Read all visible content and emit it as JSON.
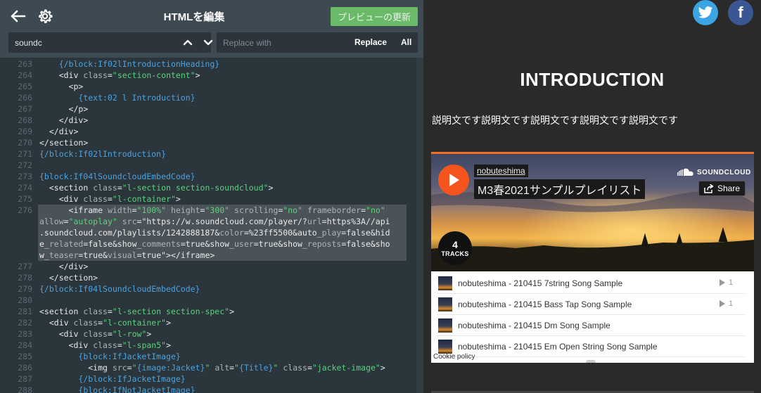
{
  "editor": {
    "title": "HTMLを編集",
    "preview_button": "プレビューの更新",
    "search_value": "soundc",
    "replace_placeholder": "Replace with",
    "replace_label": "Replace",
    "all_label": "All"
  },
  "code_lines": [
    {
      "n": "263",
      "text": "    {/block:If02lIntroductionHeading}"
    },
    {
      "n": "264",
      "text": "    <div class=\"section-content\">"
    },
    {
      "n": "265",
      "text": "      <p>"
    },
    {
      "n": "266",
      "text": "        {text:02 l Introduction}"
    },
    {
      "n": "267",
      "text": "      </p>"
    },
    {
      "n": "268",
      "text": "    </div>"
    },
    {
      "n": "269",
      "text": "  </div>"
    },
    {
      "n": "270",
      "text": "</section>"
    },
    {
      "n": "271",
      "text": "{/block:If02lIntroduction}"
    },
    {
      "n": "272",
      "text": ""
    },
    {
      "n": "273",
      "text": "{block:If04lSoundcloudEmbedCode}"
    },
    {
      "n": "274",
      "text": "  <section class=\"l-section section-soundcloud\">"
    },
    {
      "n": "275",
      "text": "    <div class=\"l-container\">"
    },
    {
      "n": "276",
      "text": "      <iframe width=\"100%\" height=\"300\" scrolling=\"no\" frameborder=\"no\""
    },
    {
      "n": "",
      "text": "allow=\"autoplay\" src=\"https://w.soundcloud.com/player/?url=https%3A//api"
    },
    {
      "n": "",
      "text": ".soundcloud.com/playlists/1242888187&color=%23ff5500&auto_play=false&hid"
    },
    {
      "n": "",
      "text": "e_related=false&show_comments=true&show_user=true&show_reposts=false&sho"
    },
    {
      "n": "",
      "text": "w_teaser=true&visual=true\"></iframe>"
    },
    {
      "n": "277",
      "text": "    </div>"
    },
    {
      "n": "278",
      "text": "  </section>"
    },
    {
      "n": "279",
      "text": "{/block:If04lSoundcloudEmbedCode}"
    },
    {
      "n": "280",
      "text": ""
    },
    {
      "n": "281",
      "text": "<section class=\"l-section section-spec\">"
    },
    {
      "n": "282",
      "text": "  <div class=\"l-container\">"
    },
    {
      "n": "283",
      "text": "    <div class=\"l-row\">"
    },
    {
      "n": "284",
      "text": "      <div class=\"l-span5\">"
    },
    {
      "n": "285",
      "text": "        {block:IfJacketImage}"
    },
    {
      "n": "286",
      "text": "          <img src=\"{image:Jacket}\" alt=\"{Title}\" class=\"jacket-image\">"
    },
    {
      "n": "287",
      "text": "        {/block:IfJacketImage}"
    },
    {
      "n": "288",
      "text": "        {block:IfNotJacketImage}"
    }
  ],
  "preview": {
    "heading": "INTRODUCTION",
    "intro_text": "説明文です説明文です説明文です説明文です説明文です",
    "soundcloud": {
      "user": "nobuteshima",
      "title": "M3春2021サンプルプレイリスト",
      "logo_text": "SOUNDCLOUD",
      "share_label": "Share",
      "track_count": "4",
      "track_count_label": "TRACKS",
      "tracks": [
        {
          "name": "nobuteshima - 210415 7string Song Sample",
          "plays": "1"
        },
        {
          "name": "nobuteshima - 210415 Bass Tap Song Sample",
          "plays": "1"
        },
        {
          "name": "nobuteshima - 210415 Dm Song Sample",
          "plays": ""
        },
        {
          "name": "nobuteshima - 210415 Em Open String Song Sample",
          "plays": ""
        }
      ],
      "cookie_policy": "Cookie policy"
    }
  },
  "colors": {
    "editor_bg": "#3e4a52",
    "code_bg": "#2b353c",
    "preview_button": "#6aba6a",
    "soundcloud_orange": "#f5541d",
    "twitter": "#3ba4e3",
    "facebook": "#3a5794"
  },
  "icons": [
    "back-arrow-icon",
    "gear-icon",
    "chevron-up-icon",
    "chevron-down-icon",
    "twitter-icon",
    "facebook-icon",
    "play-icon",
    "soundcloud-logo-icon",
    "share-icon"
  ]
}
